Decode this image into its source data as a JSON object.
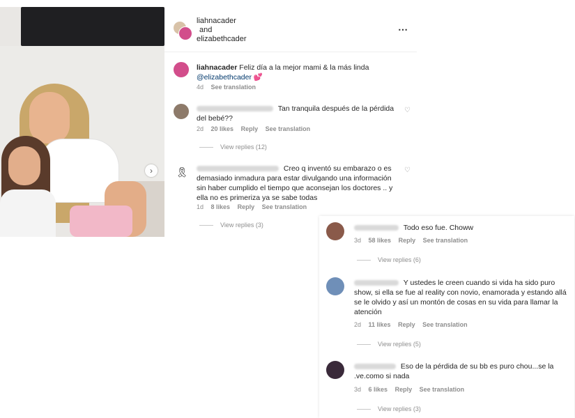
{
  "post": {
    "header": {
      "user1": "liahnacader",
      "conj": "and",
      "user2": "elizabethcader"
    },
    "caption": {
      "user": "liahnacader",
      "text": "Feliz día a la mejor mami & la más linda",
      "mention": "@elizabethcader",
      "emoji": "💕",
      "time": "4d",
      "see_translation": "See translation"
    }
  },
  "comments": [
    {
      "text": "Tan tranquila después de la pérdida del bebé??",
      "time": "2d",
      "likes": "20 likes",
      "reply": "Reply",
      "see_translation": "See translation",
      "view_replies": "View replies (12)"
    },
    {
      "avatar_icon": "black-ribbon-icon",
      "text": "Creo q inventó su embarazo o es demasiado inmadura para estar divulgando una información sin haber cumplido el tiempo que aconsejan los doctores .. y ella no es primeriza ya se sabe todas",
      "time": "1d",
      "likes": "8 likes",
      "reply": "Reply",
      "see_translation": "See translation",
      "view_replies": "View replies (3)"
    }
  ],
  "replies_card": [
    {
      "text": "Todo eso fue. Choww",
      "time": "3d",
      "likes": "58 likes",
      "reply": "Reply",
      "see_translation": "See translation",
      "view_replies": "View replies (6)"
    },
    {
      "text": "Y ustedes le creen cuando si vida ha sido puro show, si ella se fue al reality con novio, enamorada y estando allá se le olvido y así un montón de cosas en su vida para llamar la atención",
      "time": "2d",
      "likes": "11 likes",
      "reply": "Reply",
      "see_translation": "See translation",
      "view_replies": "View replies (5)"
    },
    {
      "text": "Eso de la pérdida de su bb es puro chou...se la .ve.como si nada",
      "time": "3d",
      "likes": "6 likes",
      "reply": "Reply",
      "see_translation": "See translation",
      "view_replies": "View replies (3)"
    }
  ],
  "icons": {
    "more": "⋯",
    "heart": "♡",
    "next": "›",
    "ribbon": "🎗"
  },
  "colors": {
    "link": "#00376b",
    "meta": "#8e8e8e",
    "text": "#262626"
  }
}
